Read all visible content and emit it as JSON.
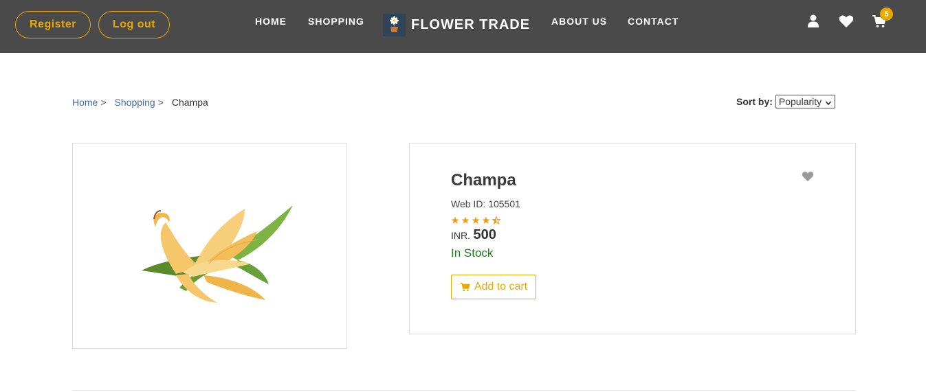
{
  "header": {
    "register_label": "Register",
    "logout_label": "Log out",
    "nav": {
      "home": "HOME",
      "shopping": "SHOPPING",
      "about": "ABOUT US",
      "contact": "CONTACT"
    },
    "brand": "FLOWER TRADE",
    "cart_count": "5",
    "icons": [
      "user-icon",
      "heart-icon",
      "cart-icon"
    ]
  },
  "breadcrumb": {
    "home": "Home",
    "shopping": "Shopping",
    "separator": ">",
    "current": "Champa"
  },
  "sort": {
    "label": "Sort by:",
    "selected": "Popularity"
  },
  "product": {
    "name": "Champa",
    "web_id": "Web ID: 105501",
    "rating": 4.5,
    "currency": "INR.",
    "price": "500",
    "stock": "In Stock",
    "add_to_cart": "Add to cart"
  },
  "colors": {
    "header_bg": "#4a4a4a",
    "accent": "#e8a900",
    "link": "#3a6ea5",
    "in_stock": "#1e7d1e"
  }
}
